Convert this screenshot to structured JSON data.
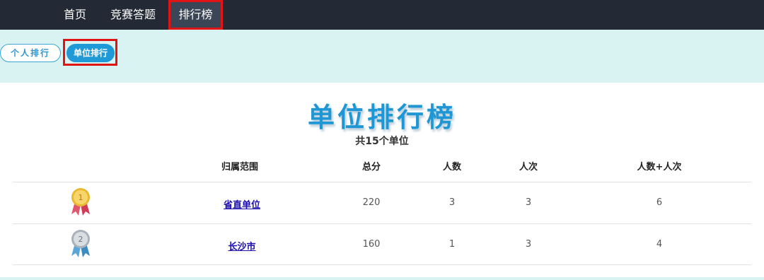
{
  "nav": {
    "home": "首页",
    "quiz": "竞赛答题",
    "ranking": "排行榜"
  },
  "tabs": {
    "personal": "个人排行",
    "unit": "单位排行"
  },
  "board": {
    "title": "单位排行榜",
    "subtitle": "共15个单位",
    "columns": {
      "scope": "归属范围",
      "score": "总分",
      "people": "人数",
      "times": "人次",
      "sum": "人数+人次"
    },
    "rows": [
      {
        "rank": "1",
        "medal": "gold-medal-icon",
        "scope": "省直单位",
        "score": "220",
        "people": "3",
        "times": "3",
        "sum": "6"
      },
      {
        "rank": "2",
        "medal": "silver-medal-icon",
        "scope": "长沙市",
        "score": "160",
        "people": "1",
        "times": "3",
        "sum": "4"
      }
    ]
  },
  "colors": {
    "nav_bg": "#232a35",
    "accent": "#1f9ad6",
    "band": "#d9f2f2",
    "highlight": "#e01414",
    "link": "#1a0dab"
  }
}
